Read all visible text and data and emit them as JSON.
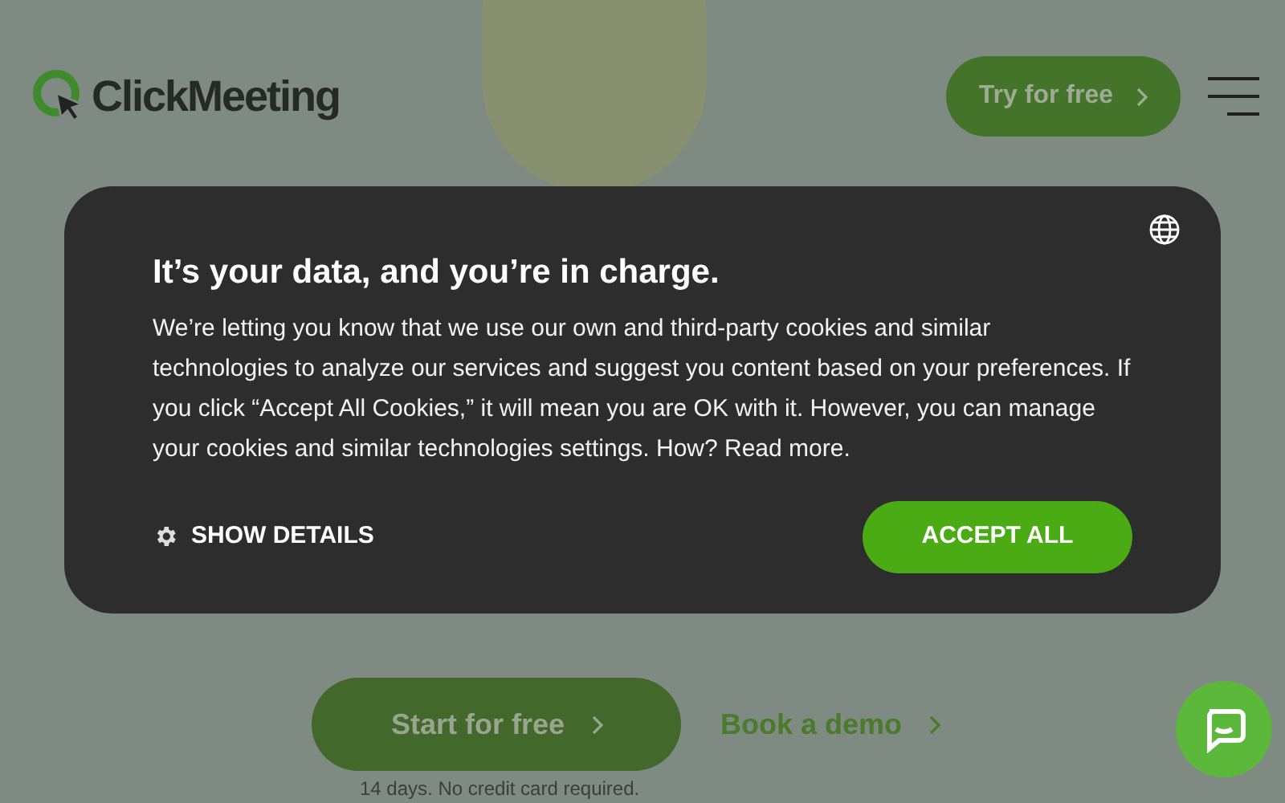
{
  "header": {
    "logo": "ClickMeeting",
    "cta": "Try for free"
  },
  "cookie_banner": {
    "title": "It’s your data, and you’re in charge.",
    "body": "We’re letting you know that we use our own and third-party cookies and similar technologies to analyze our services and suggest you content based on your preferences. If you click “Accept All Cookies,” it will mean you are OK with it. However, you can manage your cookies and similar technologies settings. How? Read more.",
    "details": "SHOW DETAILS",
    "accept": "ACCEPT ALL"
  },
  "hero": {
    "primary": "Start for free",
    "secondary": "Book a demo",
    "note": "14 days. No credit card required."
  }
}
